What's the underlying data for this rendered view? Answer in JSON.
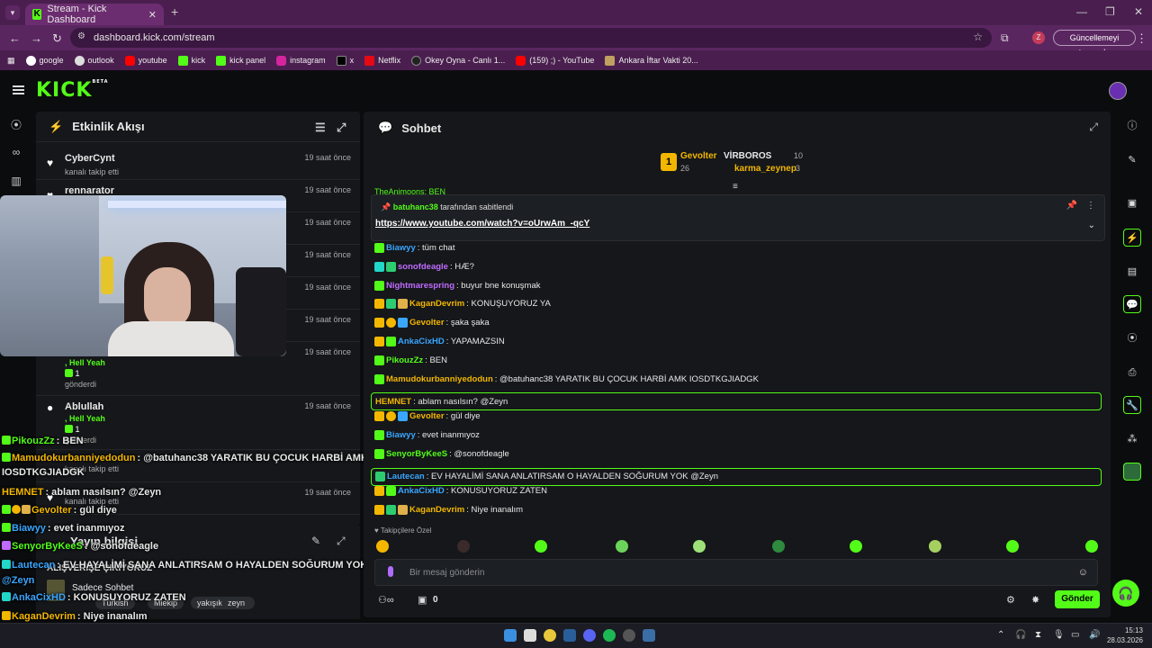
{
  "browser": {
    "tab_title": "Stream - Kick Dashboard",
    "url": "dashboard.kick.com/stream",
    "update_label": "Güncellemeyi tamamla",
    "profile_letter": "Z",
    "bookmarks": [
      "google",
      "outlook",
      "youtube",
      "kick",
      "kick panel",
      "instagram",
      "x",
      "Netflix",
      "Okey Oyna - Canlı 1...",
      "(159) ;) - YouTube",
      "Ankara İftar Vakti 20..."
    ]
  },
  "brand": {
    "logo": "KICK",
    "beta": "BETA",
    "accent": "#53fc18"
  },
  "activity": {
    "title": "Etkinlik Akışı",
    "items": [
      {
        "name": "CyberCynt",
        "sub": "kanalı takip etti",
        "time": "19 saat önce"
      },
      {
        "name": "rennarator",
        "sub": "",
        "time": "19 saat önce"
      },
      {
        "time": "19 saat önce"
      },
      {
        "time": "19 saat önce"
      },
      {
        "time": "19 saat önce"
      },
      {
        "time": "19 saat önce"
      },
      {
        "time": "19 saat önce",
        "hy": ", Hell Yeah",
        "gv": "1",
        "gd": "gönderdi"
      },
      {
        "name": "Ablullah",
        "hy": ", Hell Yeah",
        "gv": "1",
        "gd": "gönderdi",
        "time": "19 saat önce"
      },
      {
        "name": "",
        "sub": "kanalı takip etti",
        "time": ""
      },
      {
        "name": "",
        "sub": "kanalı takip etti",
        "time": "19 saat önce"
      }
    ]
  },
  "stream_info": {
    "title": "Yayın bilgisi",
    "stream_title": "ALIŞVERİŞE ÇIKIYORUZ",
    "category": "Sadece Sohbet",
    "tags": [
      "Türkish",
      "Miekip",
      "yakışıklıoğlum",
      "zeyn"
    ]
  },
  "overlay_chat": [
    {
      "user": "PikouzZz",
      "text": ": BEN",
      "color": "#53fc18"
    },
    {
      "user": "Mamudokurbanniyedodun",
      "text": ": @batuhanc38 YARATIK BU ÇOCUK HARBİ AMK",
      "color": "#f3b700"
    },
    {
      "user": "",
      "text": "IOSDTKGJIADGK",
      "color": "#fff"
    },
    {
      "user": "HEMNET",
      "text": ": ablam nasılsın? @Zeyn",
      "color": "#f3b700"
    },
    {
      "user": "Gevolter",
      "text": ": gül diye",
      "color": "#f3b700"
    },
    {
      "user": "Biawyy",
      "text": ": evet inanmıyoz",
      "color": "#3aa6ff"
    },
    {
      "user": "SenyorByKeeS",
      "text": ": @sonofdeagle",
      "color": "#c06bff"
    },
    {
      "user": "Lautecan",
      "text": ": EV HAYALİMİ SANA ANLATIRSAM O HAYALDEN SOĞURUM YOK",
      "color": "#3aa6ff"
    },
    {
      "user": "",
      "text": "@Zeyn",
      "color": "#3aa6ff"
    },
    {
      "user": "AnkaCixHD",
      "text": ": KONUSUYORUZ ZATEN",
      "color": "#3aa6ff"
    },
    {
      "user": "KaganDevrim",
      "text": ": Niye inanalım",
      "color": "#f3b700"
    }
  ],
  "chat": {
    "title": "Sohbet",
    "leaders": [
      {
        "name": "Gevolter",
        "count": "26",
        "rank": "1"
      },
      {
        "name": "VİRBOROS",
        "count": "10"
      },
      {
        "name": "karma_zeynep",
        "count": "3"
      }
    ],
    "pinned": {
      "by": "batuhanc38",
      "label": "tarafından sabitlendi",
      "link": "https://www.youtube.com/watch?v=oUrwAm_-qcY",
      "prev": "TheAnimoons: BEN"
    },
    "messages": [
      {
        "user": "Biawyy",
        "text": ": tüm chat",
        "color": "#3aa6ff",
        "badges": [
          "green"
        ]
      },
      {
        "user": "sonofdeagle",
        "text": ": HÆ?",
        "color": "#c06bff",
        "badges": [
          "mod",
          "og"
        ]
      },
      {
        "user": "Nightmarespring",
        "text": ": buyur bne konuşmak",
        "color": "#c06bff",
        "badges": [
          "green"
        ]
      },
      {
        "user": "KaganDevrim",
        "text": ": KONUŞUYORUZ YA",
        "color": "#f3b700",
        "badges": [
          "crown",
          "og",
          "vip"
        ]
      },
      {
        "user": "Gevolter",
        "text": ": şaka şaka",
        "color": "#f3b700",
        "badges": [
          "crown",
          "one",
          "sub"
        ]
      },
      {
        "user": "AnkaCixHD",
        "text": ": YAPAMAZSIN",
        "color": "#3aa6ff",
        "badges": [
          "crown",
          "green"
        ]
      },
      {
        "user": "PikouzZz",
        "text": ": BEN",
        "color": "#53fc18",
        "badges": [
          "green"
        ]
      },
      {
        "user": "Mamudokurbanniyedodun",
        "text": ": @batuhanc38 YARATIK BU ÇOCUK HARBİ AMK IOSDTKGJIADGK",
        "color": "#f3b700",
        "badges": [
          "green"
        ]
      },
      {
        "user": "HEMNET",
        "text": ": ablam nasılsın? @Zeyn",
        "color": "#f3b700",
        "badges": [],
        "hl": true
      },
      {
        "user": "Gevolter",
        "text": ": gül diye",
        "color": "#f3b700",
        "badges": [
          "crown",
          "one",
          "sub"
        ]
      },
      {
        "user": "Biawyy",
        "text": ": evet inanmıyoz",
        "color": "#3aa6ff",
        "badges": [
          "green"
        ]
      },
      {
        "user": "SenyorByKeeS",
        "text": ": @sonofdeagle",
        "color": "#53fc18",
        "badges": [
          "green"
        ]
      },
      {
        "user": "Lautecan",
        "text": ": EV HAYALİMİ SANA ANLATIRSAM O HAYALDEN SOĞURUM YOK @Zeyn",
        "color": "#3aa6ff",
        "badges": [
          "og"
        ],
        "hl": true
      },
      {
        "user": "AnkaCixHD",
        "text": ": KONUSUYORUZ ZATEN",
        "color": "#3aa6ff",
        "badges": [
          "crown",
          "green"
        ]
      },
      {
        "user": "KaganDevrim",
        "text": ": Niye inanalım",
        "color": "#f3b700",
        "badges": [
          "crown",
          "og",
          "vip"
        ]
      }
    ],
    "followers_only": "Takipçilere Özel",
    "input_placeholder": "Bir mesaj gönderin",
    "points": "0",
    "send_label": "Gönder"
  },
  "taskbar": {
    "time": "15:13",
    "date": "28.03.2026"
  }
}
